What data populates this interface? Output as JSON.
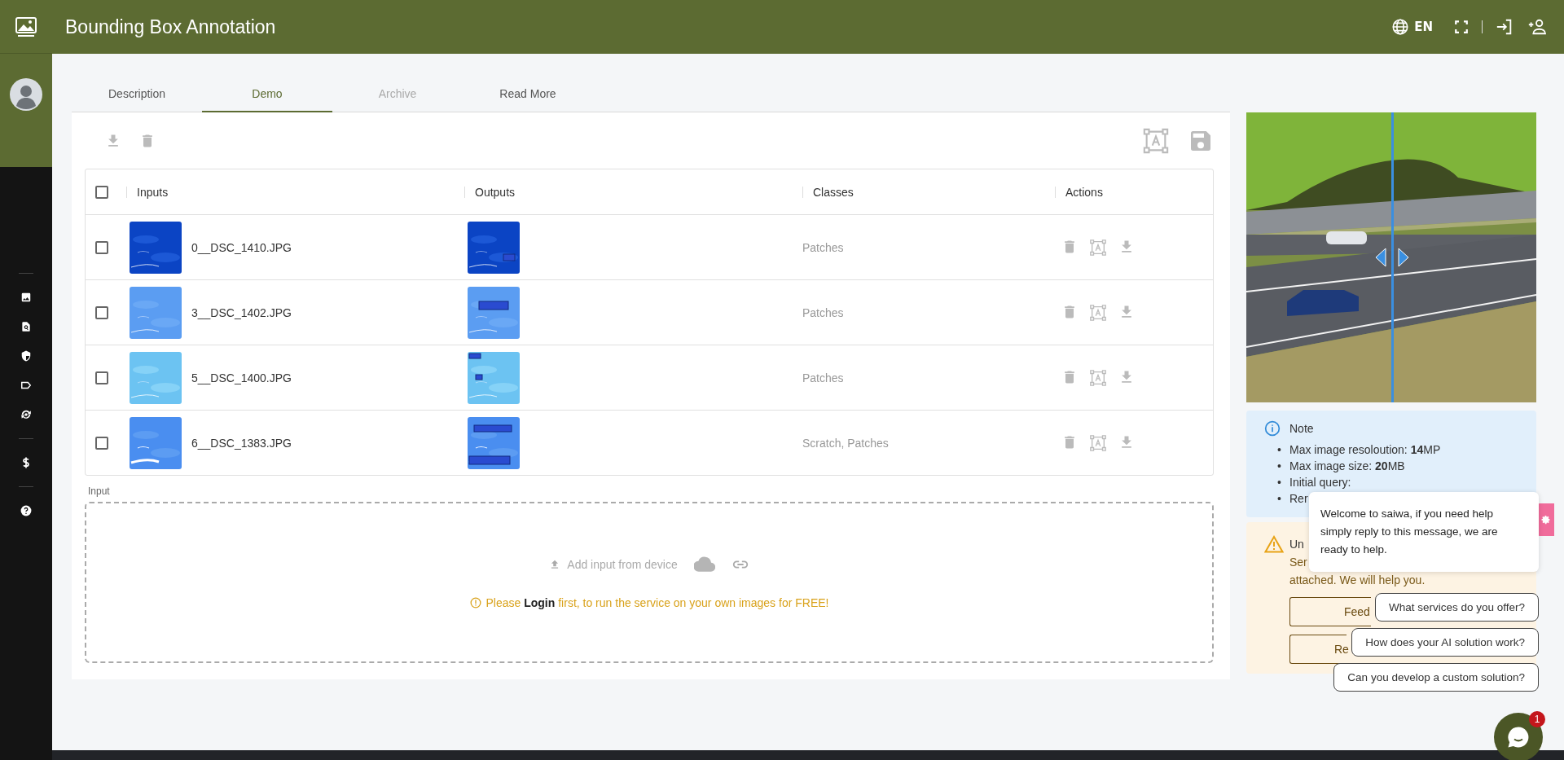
{
  "header": {
    "title": "Bounding Box Annotation",
    "language": "EN"
  },
  "tabs": [
    {
      "label": "Description",
      "selected": false,
      "disabled": false
    },
    {
      "label": "Demo",
      "selected": true,
      "disabled": false
    },
    {
      "label": "Archive",
      "selected": false,
      "disabled": true
    },
    {
      "label": "Read More",
      "selected": false,
      "disabled": false
    }
  ],
  "table": {
    "select_all": {
      "checked": false
    },
    "columns": [
      "Inputs",
      "Outputs",
      "Classes",
      "Actions"
    ],
    "rows": [
      {
        "checked": false,
        "input": "0__DSC_1410.JPG",
        "classes": "Patches"
      },
      {
        "checked": false,
        "input": "3__DSC_1402.JPG",
        "classes": "Patches"
      },
      {
        "checked": false,
        "input": "5__DSC_1400.JPG",
        "classes": "Patches"
      },
      {
        "checked": false,
        "input": "6__DSC_1383.JPG",
        "classes": "Scratch, Patches"
      }
    ]
  },
  "upload": {
    "label": "Input",
    "add_text": "Add input from device",
    "login_notice": "Please **Login** first, to run the service on your own images for FREE!"
  },
  "note": {
    "title": "Note",
    "bullet": "•",
    "items": [
      "Max image resoloution: **14**MP",
      "Max image size: **20**MB",
      "Initial query:",
      "Rer"
    ]
  },
  "warning": {
    "title": "Un",
    "lines": [
      "Ser",
      "attached. We will help you."
    ],
    "buttons": [
      "Feed",
      "Re"
    ]
  },
  "chat": {
    "message": "Welcome to saiwa, if you need help simply reply to this message, we are ready to help.",
    "quick_replies": [
      "What services do you offer?",
      "How does your AI solution work?",
      "Can you develop a custom solution?"
    ],
    "badge": "1"
  }
}
